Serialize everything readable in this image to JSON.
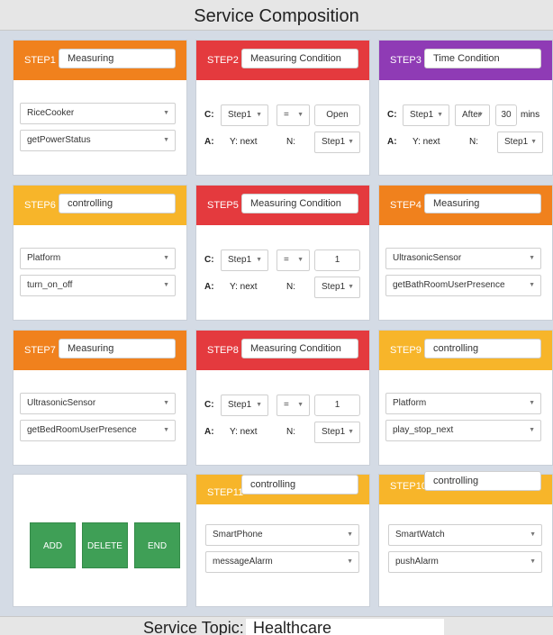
{
  "title": "Service Composition",
  "colors": {
    "orange": "#f0811d",
    "red": "#e43a3e",
    "purple": "#8f3bb5",
    "yellow": "#f7b52a",
    "green": "#3f9f56"
  },
  "steps": {
    "step1": {
      "label": "STEP1",
      "name": "Measuring",
      "device": "RiceCooker",
      "method": "getPowerStatus"
    },
    "step2": {
      "label": "STEP2",
      "name": "Measuring Condition",
      "c_label": "C:",
      "c_step": "Step1",
      "c_op": "=",
      "c_value": "Open",
      "a_label": "A:",
      "y_text": "Y: next",
      "n_label": "N:",
      "n_step": "Step1"
    },
    "step3": {
      "label": "STEP3",
      "name": "Time Condition",
      "c_label": "C:",
      "c_step": "Step1",
      "c_op": "After",
      "c_value": "30",
      "unit": "mins",
      "a_label": "A:",
      "y_text": "Y: next",
      "n_label": "N:",
      "n_step": "Step1"
    },
    "step6": {
      "label": "STEP6",
      "name": "controlling",
      "device": "Platform",
      "method": "turn_on_off"
    },
    "step5": {
      "label": "STEP5",
      "name": "Measuring Condition",
      "c_label": "C:",
      "c_step": "Step1",
      "c_op": "=",
      "c_value": "1",
      "a_label": "A:",
      "y_text": "Y: next",
      "n_label": "N:",
      "n_step": "Step1"
    },
    "step4": {
      "label": "STEP4",
      "name": "Measuring",
      "device": "UltrasonicSensor",
      "method": "getBathRoomUserPresence"
    },
    "step7": {
      "label": "STEP7",
      "name": "Measuring",
      "device": "UltrasonicSensor",
      "method": "getBedRoomUserPresence"
    },
    "step8": {
      "label": "STEP8",
      "name": "Measuring Condition",
      "c_label": "C:",
      "c_step": "Step1",
      "c_op": "=",
      "c_value": "1",
      "a_label": "A:",
      "y_text": "Y: next",
      "n_label": "N:",
      "n_step": "Step1"
    },
    "step9": {
      "label": "STEP9",
      "name": "controlling",
      "device": "Platform",
      "method": "play_stop_next"
    },
    "step11": {
      "label": "STEP11",
      "name": "controlling",
      "device": "SmartPhone",
      "method": "messageAlarm"
    },
    "step10": {
      "label": "STEP10",
      "name": "controlling",
      "device": "SmartWatch",
      "method": "pushAlarm"
    }
  },
  "buttons": {
    "add": "ADD",
    "delete": "DELETE",
    "end": "END"
  },
  "topic": {
    "label": "Service Topic:",
    "value": "Healthcare"
  }
}
